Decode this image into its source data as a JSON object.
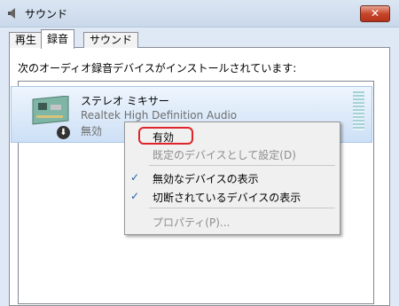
{
  "window": {
    "title": "サウンド",
    "close_label": "✕"
  },
  "tabs": [
    {
      "label": "再生"
    },
    {
      "label": "録音"
    },
    {
      "label": "サウンド"
    }
  ],
  "recording": {
    "heading": "次のオーディオ録音デバイスがインストールされています:",
    "device": {
      "name": "ステレオ ミキサー",
      "description": "Realtek High Definition Audio",
      "status": "無効"
    }
  },
  "context_menu": {
    "items": [
      {
        "label": "有効",
        "enabled": true
      },
      {
        "label": "既定のデバイスとして設定(D)",
        "enabled": false
      },
      {
        "label": "無効なデバイスの表示",
        "checked": true
      },
      {
        "label": "切断されているデバイスの表示",
        "checked": true
      },
      {
        "label": "プロパティ(P)...",
        "enabled": false
      }
    ],
    "check_mark": "✓"
  },
  "colors": {
    "highlight_border": "#e0242a",
    "selected_device_bg": "#cde0f6",
    "check_color": "#215fa8"
  }
}
